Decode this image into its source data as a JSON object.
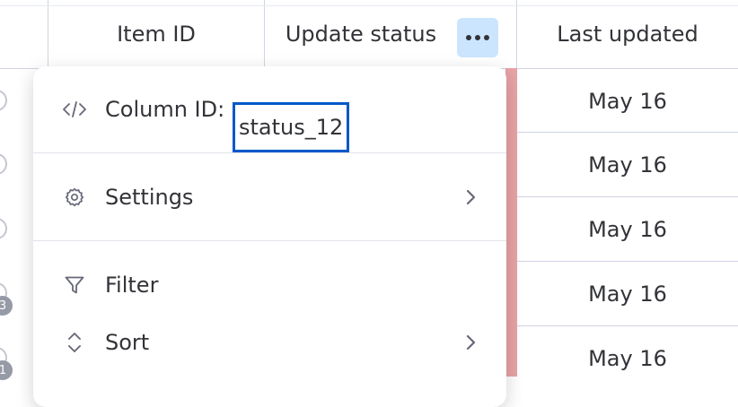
{
  "header": {
    "item_id_label": "Item ID",
    "update_status_label": "Update status",
    "last_updated_label": "Last updated"
  },
  "rows": [
    {
      "last_updated": "May 16"
    },
    {
      "last_updated": "May 16"
    },
    {
      "last_updated": "May 16"
    },
    {
      "last_updated": "May 16"
    },
    {
      "last_updated": "May 16"
    }
  ],
  "badges": [
    "3",
    "1"
  ],
  "menu": {
    "column_id_label": "Column ID:",
    "column_id_value": "status_12",
    "settings_label": "Settings",
    "filter_label": "Filter",
    "sort_label": "Sort"
  },
  "colors": {
    "accent_highlight": "#0058c8",
    "active_button_bg": "#cce5ff",
    "status_strip": "#e8a3a6"
  }
}
